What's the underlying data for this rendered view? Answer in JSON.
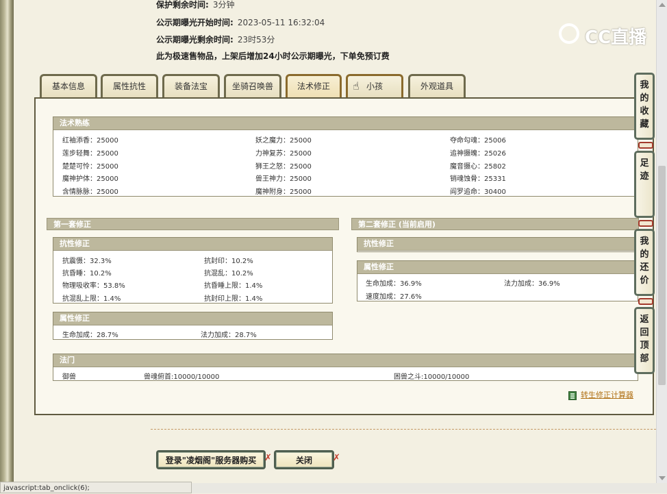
{
  "header": {
    "protect_label": "保护剩余时间:",
    "protect_value": "3分钟",
    "publicity_start_label": "公示期曝光开始时间:",
    "publicity_start_value": "2023-05-11 16:32:04",
    "publicity_left_label": "公示期曝光剩余时间:",
    "publicity_left_value": "23时53分",
    "notice": "此为极速售物品，上架后增加24小时公示期曝光，下单免预订费"
  },
  "logo": {
    "text": "CC直播"
  },
  "tabs": [
    {
      "label": "基本信息"
    },
    {
      "label": "属性抗性"
    },
    {
      "label": "装备法宝"
    },
    {
      "label": "坐骑召唤兽"
    },
    {
      "label": "法术修正"
    },
    {
      "label": "小孩"
    },
    {
      "label": "外观道具"
    }
  ],
  "spell_mastery": {
    "title": "法术熟练",
    "rows": [
      [
        "红袖添香：25000",
        "妖之魔力：25000",
        "夺命勾魂：25006"
      ],
      [
        "莲步轻舞：25000",
        "力神复苏：25000",
        "追神摄魄：25026"
      ],
      [
        "楚楚可怜：25000",
        "狮王之怒：25000",
        "魔音摄心：25802"
      ],
      [
        "魔神护体：25000",
        "兽王神力：25000",
        "销魂蚀骨：25331"
      ],
      [
        "含情脉脉：25000",
        "魔神附身：25000",
        "阎罗追命：30400"
      ]
    ]
  },
  "set1": {
    "title": "第一套修正",
    "resist": {
      "title": "抗性修正",
      "rows": [
        [
          "抗震慑：32.3%",
          "抗封印：10.2%"
        ],
        [
          "抗昏睡：10.2%",
          "抗混乱：10.2%"
        ],
        [
          "物理吸收率：53.8%",
          "抗昏睡上限：1.4%"
        ],
        [
          "抗混乱上限：1.4%",
          "抗封印上限：1.4%"
        ]
      ]
    },
    "attr": {
      "title": "属性修正",
      "rows": [
        [
          "生命加成：28.7%",
          "法力加成：28.7%"
        ]
      ]
    }
  },
  "set2": {
    "title": "第二套修正 (当前启用)",
    "resist": {
      "title": "抗性修正"
    },
    "attr": {
      "title": "属性修正",
      "rows": [
        [
          "生命加成：36.9%",
          "法力加成：36.9%"
        ],
        [
          "速度加成：27.6%",
          ""
        ]
      ]
    }
  },
  "fabao": {
    "title": "法门",
    "name": "御兽",
    "items": [
      "兽魂俯首:10000/10000",
      "困兽之斗:10000/10000"
    ]
  },
  "calc_link": "转生修正计算器",
  "buttons": {
    "login_buy": "登录\"凌烟阁\"服务器购买",
    "close": "关闭"
  },
  "float_menu": {
    "favorites": "我的收藏",
    "footprints": "足迹",
    "bargain": "我的还价",
    "back_top": "返回顶部"
  },
  "status": "javascript:tab_onclick(6);"
}
